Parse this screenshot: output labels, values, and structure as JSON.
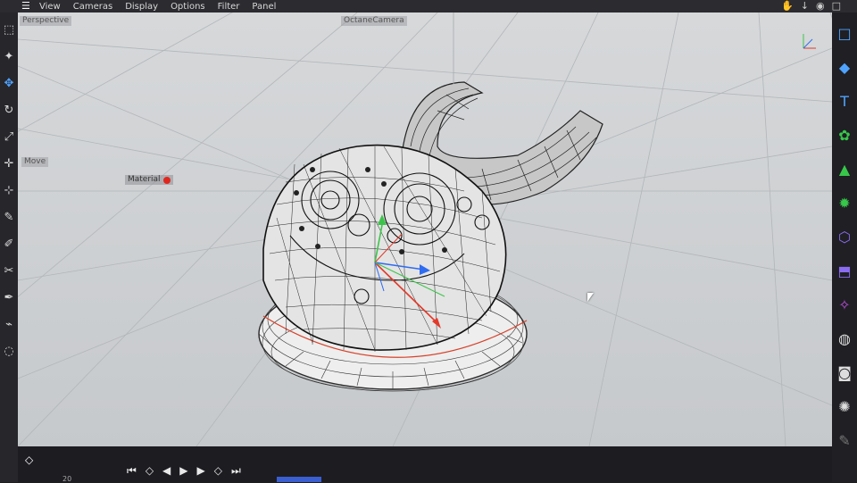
{
  "menubar": {
    "items": [
      "View",
      "Cameras",
      "Display",
      "Options",
      "Filter",
      "Panel"
    ]
  },
  "viewport": {
    "perspective_label": "Perspective",
    "camera_label": "OctaneCamera",
    "move_label": "Move",
    "material_label": "Material"
  },
  "timeline": {
    "frame": "20"
  },
  "colors": {
    "accent": "#4fa3ff",
    "material_dot": "#e0271e",
    "viewport_bg": "#cfd2d5"
  },
  "left_toolbar_icons": [
    "select-icon",
    "move-icon",
    "rotate-icon",
    "scale-icon",
    "transform-icon",
    "axis-icon",
    "pen-icon",
    "brush-icon",
    "knife-icon",
    "paint-icon",
    "spline-pen-icon",
    "eraser-icon"
  ],
  "right_toolbar_icons": [
    "cube-icon",
    "text-icon",
    "cloner-icon",
    "effector-icon",
    "generator-icon",
    "deformer-icon",
    "field-icon",
    "scene-icon",
    "camera-st-icon",
    "light-st-icon"
  ]
}
